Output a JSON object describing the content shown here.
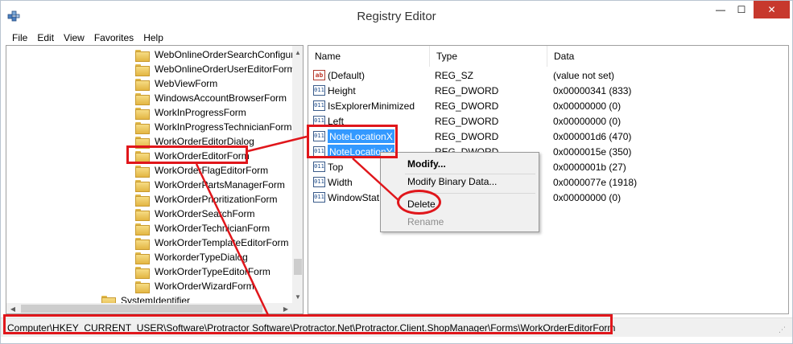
{
  "window": {
    "title": "Registry Editor",
    "close_glyph": "✕",
    "max_glyph": "☐",
    "min_glyph": "—"
  },
  "menu": [
    "File",
    "Edit",
    "View",
    "Favorites",
    "Help"
  ],
  "tree": {
    "items": [
      "WebOnlineOrderSearchConfigura",
      "WebOnlineOrderUserEditorForm",
      "WebViewForm",
      "WindowsAccountBrowserForm",
      "WorkInProgressForm",
      "WorkInProgressTechnicianForm",
      "WorkOrderEditorDialog",
      "WorkOrderEditorForm",
      "WorkOrderFlagEditorForm",
      "WorkOrderPartsManagerForm",
      "WorkOrderPrioritizationForm",
      "WorkOrderSearchForm",
      "WorkOrderTechnicianForm",
      "WorkOrderTemplateEditorForm",
      "WorkorderTypeDialog",
      "WorkOrderTypeEditorForm",
      "WorkOrderWizardForm",
      "SystemIdentifier"
    ],
    "selected": "WorkOrderEditorForm"
  },
  "list": {
    "columns": [
      "Name",
      "Type",
      "Data"
    ],
    "rows": [
      {
        "icon": "ab",
        "name": "(Default)",
        "type": "REG_SZ",
        "data": "(value not set)"
      },
      {
        "icon": "011",
        "name": "Height",
        "type": "REG_DWORD",
        "data": "0x00000341 (833)"
      },
      {
        "icon": "011",
        "name": "IsExplorerMinimized",
        "type": "REG_DWORD",
        "data": "0x00000000 (0)"
      },
      {
        "icon": "011",
        "name": "Left",
        "type": "REG_DWORD",
        "data": "0x00000000 (0)"
      },
      {
        "icon": "011",
        "name": "NoteLocationX",
        "type": "REG_DWORD",
        "data": "0x000001d6 (470)"
      },
      {
        "icon": "011",
        "name": "NoteLocationY",
        "type": "REG_DWORD",
        "data": "0x0000015e (350)"
      },
      {
        "icon": "011",
        "name": "Top",
        "type": "",
        "data": "0x0000001b (27)"
      },
      {
        "icon": "011",
        "name": "Width",
        "type": "",
        "data": "0x0000077e (1918)"
      },
      {
        "icon": "011",
        "name": "WindowStat",
        "type": "",
        "data": "0x00000000 (0)"
      }
    ]
  },
  "context_menu": {
    "items": [
      "Modify...",
      "Modify Binary Data...",
      "Delete",
      "Rename"
    ]
  },
  "statusbar": {
    "path": "Computer\\HKEY_CURRENT_USER\\Software\\Protractor Software\\Protractor.Net\\Protractor.Client.ShopManager\\Forms\\WorkOrderEditorForm"
  },
  "colors": {
    "selection": "#3399ff",
    "annotation": "#e0161b",
    "close_button": "#c7382d"
  }
}
